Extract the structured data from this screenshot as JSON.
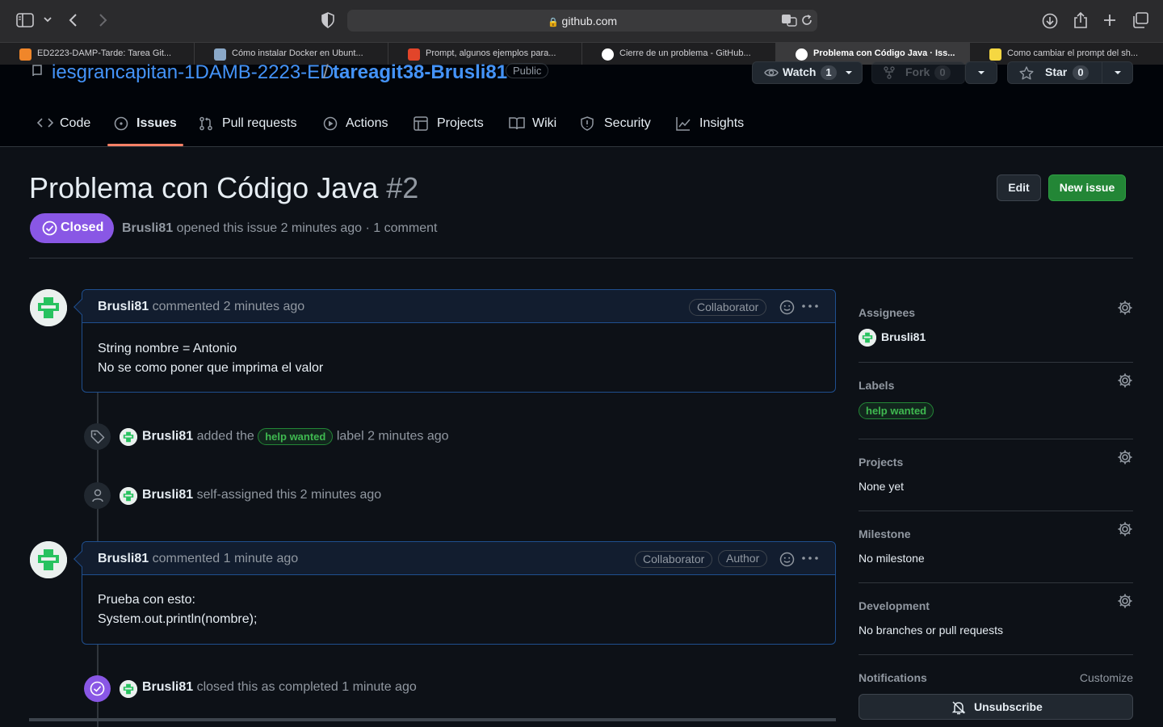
{
  "browser": {
    "url": "github.com",
    "tabs": [
      {
        "label": "ED2223-DAMP-Tarde: Tarea Git...",
        "favicon_color": "#f0862a"
      },
      {
        "label": "Cómo instalar Docker en Ubunt...",
        "favicon_color": "#8aa8c8"
      },
      {
        "label": "Prompt, algunos ejemplos para...",
        "favicon_color": "#e2452a"
      },
      {
        "label": "Cierre de un problema - GitHub...",
        "favicon_color": "#ffffff"
      },
      {
        "label": "Problema con Código Java · Iss...",
        "favicon_color": "#ffffff",
        "active": true
      },
      {
        "label": "Como cambiar el prompt del sh...",
        "favicon_color": "#f5d742"
      }
    ]
  },
  "repo": {
    "owner": "iesgrancapitan-1DAMB-2223-ED",
    "separator": "/",
    "name": "tareagit38-Brusli81",
    "visibility": "Public",
    "watch_label": "Watch",
    "watch_count": "1",
    "fork_label": "Fork",
    "fork_count": "0",
    "star_label": "Star",
    "star_count": "0"
  },
  "nav": {
    "tabs": [
      {
        "label": "Code",
        "icon": "code-icon"
      },
      {
        "label": "Issues",
        "icon": "issue-icon",
        "selected": true
      },
      {
        "label": "Pull requests",
        "icon": "pull-request-icon"
      },
      {
        "label": "Actions",
        "icon": "play-icon"
      },
      {
        "label": "Projects",
        "icon": "table-icon"
      },
      {
        "label": "Wiki",
        "icon": "book-icon"
      },
      {
        "label": "Security",
        "icon": "shield-icon"
      },
      {
        "label": "Insights",
        "icon": "graph-icon"
      }
    ]
  },
  "issue": {
    "title": "Problema con Código Java",
    "number": "#2",
    "edit_label": "Edit",
    "new_issue_label": "New issue",
    "state": "Closed",
    "author": "Brusli81",
    "meta": "opened this issue 2 minutes ago · 1 comment"
  },
  "timeline": {
    "comment1": {
      "author": "Brusli81",
      "time": "commented 2 minutes ago",
      "roles": [
        "Collaborator"
      ],
      "body_lines": [
        "String nombre = Antonio",
        "No se como poner que imprima el valor"
      ]
    },
    "event_label": {
      "author": "Brusli81",
      "pre": "added the",
      "label": "help wanted",
      "post": "label 2 minutes ago"
    },
    "event_assign": {
      "author": "Brusli81",
      "text": "self-assigned this 2 minutes ago"
    },
    "comment2": {
      "author": "Brusli81",
      "time": "commented 1 minute ago",
      "roles": [
        "Collaborator",
        "Author"
      ],
      "body_lines": [
        "Prueba con esto:",
        "System.out.println(nombre);"
      ]
    },
    "event_closed": {
      "author": "Brusli81",
      "text": "closed this as completed 1 minute ago"
    }
  },
  "sidebar": {
    "assignees": {
      "heading": "Assignees",
      "value": "Brusli81"
    },
    "labels": {
      "heading": "Labels",
      "value": "help wanted"
    },
    "projects": {
      "heading": "Projects",
      "value": "None yet"
    },
    "milestone": {
      "heading": "Milestone",
      "value": "No milestone"
    },
    "development": {
      "heading": "Development",
      "value": "No branches or pull requests"
    },
    "notifications": {
      "heading": "Notifications",
      "customize": "Customize",
      "unsubscribe": "Unsubscribe"
    }
  },
  "colors": {
    "background": "#0d1117",
    "header_bg": "#010409",
    "link": "#4493f8",
    "closed_purple": "#8957e5",
    "new_issue_green": "#238636",
    "label_green": "#3fb950",
    "tab_underline": "#f78166"
  }
}
